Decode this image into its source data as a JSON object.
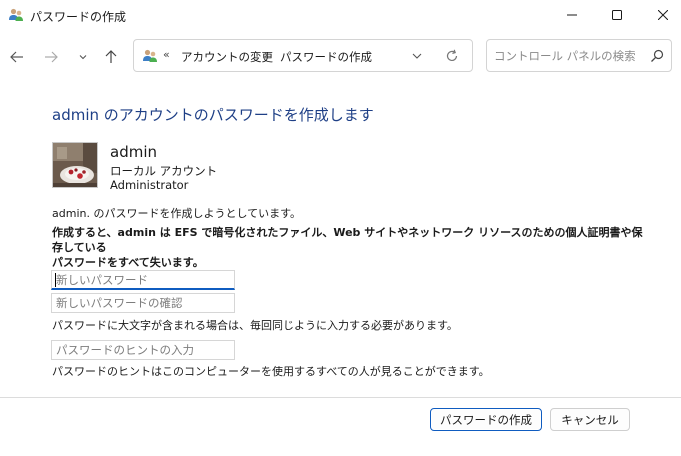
{
  "window": {
    "title": "パスワードの作成"
  },
  "nav": {
    "breadcrumb_overflow": "«",
    "breadcrumb_1": "アカウントの変更",
    "breadcrumb_separator": "›",
    "breadcrumb_2": "パスワードの作成",
    "search_placeholder": "コントロール パネルの検索"
  },
  "page": {
    "title": "admin のアカウントのパスワードを作成します",
    "user_name": "admin",
    "account_type": "ローカル アカウント",
    "account_role": "Administrator",
    "intro": "admin. のパスワードを作成しようとしています。",
    "warning_line1": "作成すると、admin は EFS で暗号化されたファイル、Web サイトやネットワーク リソースのための個人証明書や保存している",
    "warning_line2": "パスワードをすべて失います。",
    "new_password_placeholder": "新しいパスワード",
    "confirm_password_placeholder": "新しいパスワードの確認",
    "case_note": "パスワードに大文字が含まれる場合は、毎回同じように入力する必要があります。",
    "hint_placeholder": "パスワードのヒントの入力",
    "hint_note": "パスワードのヒントはこのコンピューターを使用するすべての人が見ることができます。"
  },
  "buttons": {
    "create": "パスワードの作成",
    "cancel": "キャンセル"
  },
  "colors": {
    "title_blue": "#1e3f86",
    "accent": "#0f5cc0"
  },
  "icons": {
    "app": "users-icon",
    "back": "arrow-left-icon",
    "forward": "arrow-right-icon",
    "recent": "chevron-down-icon",
    "up": "arrow-up-icon",
    "refresh": "refresh-icon",
    "search": "search-icon"
  }
}
